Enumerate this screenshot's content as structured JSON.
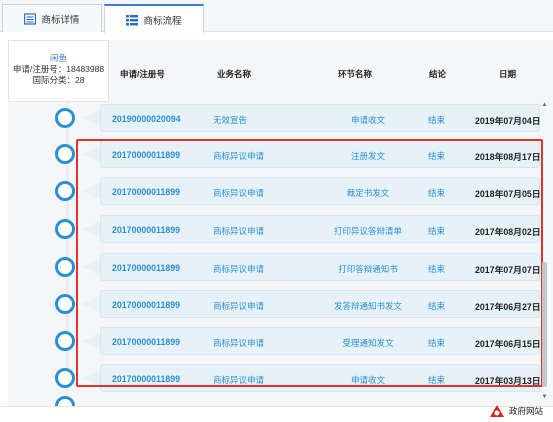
{
  "tabs": [
    {
      "label": "商标详情",
      "active": false
    },
    {
      "label": "商标流程",
      "active": true
    }
  ],
  "trademark": {
    "brand": "闲鱼",
    "reg_no": "申请/注册号：18483988",
    "class": "国际分类：28"
  },
  "columns": [
    "申请/注册号",
    "业务名称",
    "环节名称",
    "结论",
    "日期"
  ],
  "rows": [
    {
      "no": "20190000020094",
      "biz": "无效宣告",
      "step": "申请收文",
      "result": "结束",
      "date": "2019年07月04日"
    },
    {
      "no": "20170000011899",
      "biz": "商标异议申请",
      "step": "注册发文",
      "result": "结束",
      "date": "2018年08月17日"
    },
    {
      "no": "20170000011899",
      "biz": "商标异议申请",
      "step": "裁定书发文",
      "result": "结束",
      "date": "2018年07月05日"
    },
    {
      "no": "20170000011899",
      "biz": "商标异议申请",
      "step": "打印异议答辩清单",
      "result": "结束",
      "date": "2017年08月02日"
    },
    {
      "no": "20170000011899",
      "biz": "商标异议申请",
      "step": "打印答辩通知书",
      "result": "结束",
      "date": "2017年07月07日"
    },
    {
      "no": "20170000011899",
      "biz": "商标异议申请",
      "step": "发答辩通知书发文",
      "result": "结束",
      "date": "2017年06月27日"
    },
    {
      "no": "20170000011899",
      "biz": "商标异议申请",
      "step": "受理通知发文",
      "result": "结束",
      "date": "2017年06月15日"
    },
    {
      "no": "20170000011899",
      "biz": "商标异议申请",
      "step": "申请收文",
      "result": "结束",
      "date": "2017年03月13日"
    }
  ],
  "footer": {
    "site_label": "政府网站"
  },
  "colors": {
    "accent": "#2b8fd6",
    "highlight": "#e2322d",
    "row_bg": "#e6f2f8"
  }
}
